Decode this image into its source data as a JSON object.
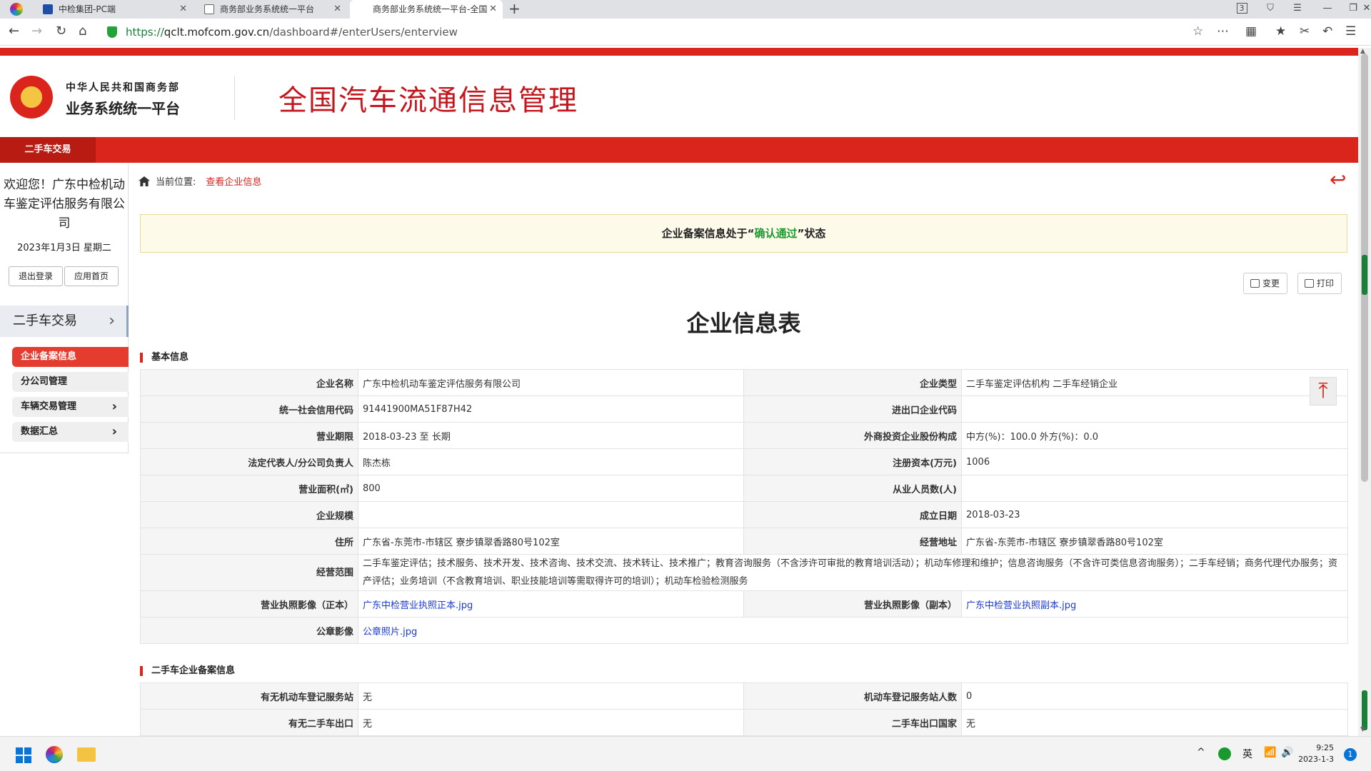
{
  "browser": {
    "tabs": [
      {
        "title": "中检集团-PC端"
      },
      {
        "title": "商务部业务系统统一平台"
      },
      {
        "title": "商务部业务系统统一平台-全国"
      }
    ],
    "tab_count_badge": "3",
    "url_protocol": "https://",
    "url_host": "qclt.mofcom.gov.cn",
    "url_path": "/dashboard#/enterUsers/enterview"
  },
  "header": {
    "org_line1": "中华人民共和国商务部",
    "org_line2": "业务系统统一平台",
    "system_title": "全国汽车流通信息管理"
  },
  "top_nav": {
    "active_item": "二手车交易"
  },
  "sidebar": {
    "welcome": "欢迎您！广东中检机动车鉴定评估服务有限公司",
    "date": "2023年1月3日 星期二",
    "logout_label": "退出登录",
    "home_label": "应用首页",
    "section_title": "二手车交易",
    "menu": [
      {
        "label": "企业备案信息",
        "active": true
      },
      {
        "label": "分公司管理"
      },
      {
        "label": "车辆交易管理"
      },
      {
        "label": "数据汇总"
      }
    ]
  },
  "breadcrumb": {
    "prefix": "当前位置:",
    "current": "查看企业信息"
  },
  "notice": {
    "before": "企业备案信息处于“",
    "status": "确认通过",
    "after": "”状态"
  },
  "toolbar": {
    "change_label": "变更",
    "print_label": "打印"
  },
  "form_title": "企业信息表",
  "basic_section": {
    "title": "基本信息",
    "rows": [
      {
        "l1": "企业名称",
        "v1": "广东中检机动车鉴定评估服务有限公司",
        "l2": "企业类型",
        "v2": "二手车鉴定评估机构 二手车经销企业"
      },
      {
        "l1": "统一社会信用代码",
        "v1": "91441900MA51F87H42",
        "l2": "进出口企业代码",
        "v2": ""
      },
      {
        "l1": "营业期限",
        "v1": "2018-03-23 至 长期",
        "l2": "外商投资企业股份构成",
        "v2": "中方(%)：100.0 外方(%)：0.0"
      },
      {
        "l1": "法定代表人/分公司负责人",
        "v1": "陈杰栋",
        "l2": "注册资本(万元)",
        "v2": "1006"
      },
      {
        "l1": "营业面积(㎡)",
        "v1": "800",
        "l2": "从业人员数(人)",
        "v2": ""
      },
      {
        "l1": "企业规模",
        "v1": "",
        "l2": "成立日期",
        "v2": "2018-03-23"
      },
      {
        "l1": "住所",
        "v1": "广东省-东莞市-市辖区 寮步镇翠香路80号102室",
        "l2": "经营地址",
        "v2": "广东省-东莞市-市辖区 寮步镇翠香路80号102室"
      }
    ],
    "scope_label": "经营范围",
    "scope_value": "二手车鉴定评估；技术服务、技术开发、技术咨询、技术交流、技术转让、技术推广；教育咨询服务（不含涉许可审批的教育培训活动）；机动车修理和维护；信息咨询服务（不含许可类信息咨询服务）；二手车经销；商务代理代办服务；资产评估；业务培训（不含教育培训、职业技能培训等需取得许可的培训）；机动车检验检测服务",
    "license_main_label": "营业执照影像（正本）",
    "license_main_file": "广东中检营业执照正本.jpg",
    "license_copy_label": "营业执照影像（副本）",
    "license_copy_file": "广东中检营业执照副本.jpg",
    "seal_label": "公章影像",
    "seal_file": "公章照片.jpg"
  },
  "usedcar_section": {
    "title": "二手车企业备案信息",
    "rows": [
      {
        "l1": "有无机动车登记服务站",
        "v1": "无",
        "l2": "机动车登记服务站人数",
        "v2": "0"
      },
      {
        "l1": "有无二手车出口",
        "v1": "无",
        "l2": "二手车出口国家",
        "v2": "无"
      }
    ]
  },
  "taskbar": {
    "ime": "英",
    "time": "9:25",
    "date": "2023-1-3",
    "notifications": "1"
  },
  "colors": {
    "brand_red": "#d9251c",
    "link_blue": "#1c3ad6",
    "status_green": "#1a9a2e"
  }
}
